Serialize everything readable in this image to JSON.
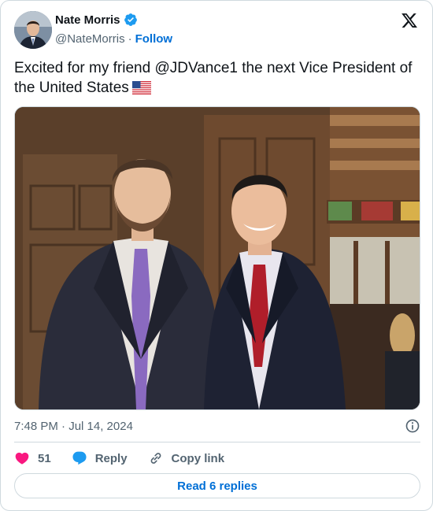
{
  "author": {
    "name": "Nate Morris",
    "handle": "@NateMorris",
    "separator": "·",
    "follow_label": "Follow"
  },
  "tweet": {
    "text": "Excited for my friend @JDVance1 the next Vice President of the United States",
    "flag_icon": "us-flag-icon",
    "photo_alt": "Photo"
  },
  "meta": {
    "timestamp": "7:48 PM · Jul 14, 2024"
  },
  "actions": {
    "like_count": "51",
    "reply_label": "Reply",
    "copy_link_label": "Copy link"
  },
  "footer": {
    "read_replies_label": "Read 6 replies"
  },
  "colors": {
    "accent": "#006fd6",
    "like": "#f91880",
    "reply": "#1d9bf0",
    "muted": "#536471",
    "border": "#cfd9de"
  }
}
